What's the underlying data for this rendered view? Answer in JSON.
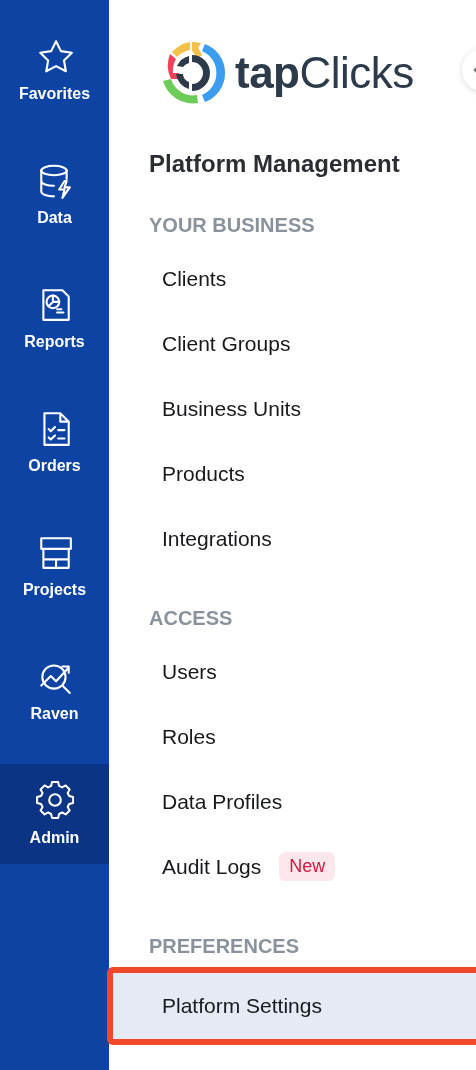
{
  "rail": [
    {
      "label": "Favorites",
      "kind": "star",
      "selected": false
    },
    {
      "label": "Data",
      "kind": "database",
      "selected": false
    },
    {
      "label": "Reports",
      "kind": "report",
      "selected": false
    },
    {
      "label": "Orders",
      "kind": "checklist",
      "selected": false
    },
    {
      "label": "Projects",
      "kind": "store",
      "selected": false
    },
    {
      "label": "Raven",
      "kind": "trend",
      "selected": false
    },
    {
      "label": "Admin",
      "kind": "gear",
      "selected": true
    }
  ],
  "logo": {
    "text": "**tap**Clicks"
  },
  "panel": {
    "title": "Platform Management",
    "sections": [
      {
        "heading": "YOUR BUSINESS",
        "items": [
          {
            "label": "Clients",
            "selected": false
          },
          {
            "label": "Client Groups",
            "selected": false
          },
          {
            "label": "Business Units",
            "selected": false
          },
          {
            "label": "Products",
            "selected": false
          },
          {
            "label": "Integrations",
            "selected": false
          }
        ]
      },
      {
        "heading": "ACCESS",
        "items": [
          {
            "label": "Users",
            "selected": false
          },
          {
            "label": "Roles",
            "selected": false
          },
          {
            "label": "Data Profiles",
            "selected": false
          },
          {
            "label": "Audit Logs",
            "selected": false,
            "badge": "New"
          }
        ]
      },
      {
        "heading": "PREFERENCES",
        "items": [
          {
            "label": "Platform Settings",
            "selected": true,
            "highlighted": true
          }
        ]
      }
    ]
  }
}
